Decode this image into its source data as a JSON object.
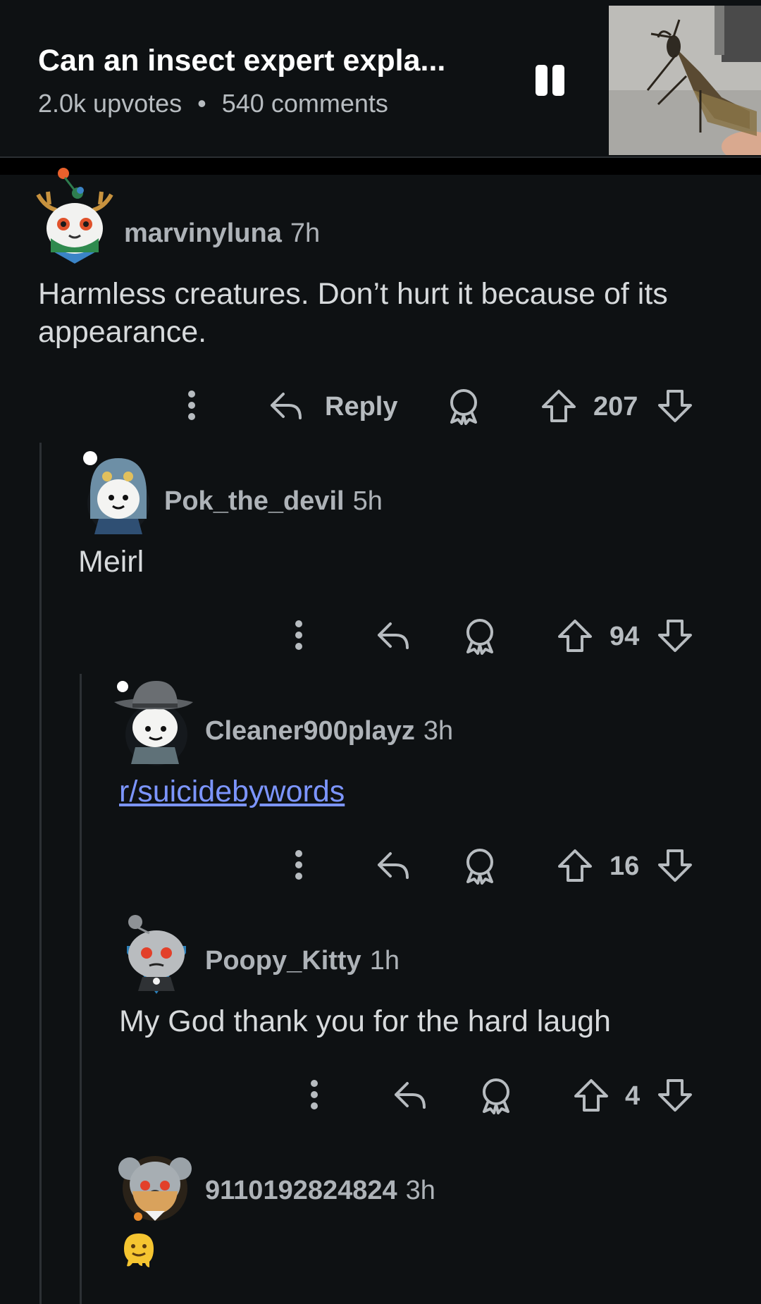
{
  "post": {
    "title": "Can an insect expert expla...",
    "upvotes": "2.0k upvotes",
    "separator": "•",
    "comments": "540 comments"
  },
  "actions": {
    "reply_label": "Reply"
  },
  "comments": [
    {
      "author": "marvinyluna",
      "age": "7h",
      "body": "Harmless creatures. Don’t hurt it because of its appearance.",
      "score": "207"
    },
    {
      "author": "Pok_the_devil",
      "age": "5h",
      "body": "Meirl",
      "score": "94"
    },
    {
      "author": "Cleaner900playz",
      "age": "3h",
      "body": "r/suicidebywords",
      "score": "16"
    },
    {
      "author": "Poopy_Kitty",
      "age": "1h",
      "body": "My God thank you for the hard laugh",
      "score": "4"
    },
    {
      "author": "9110192824824",
      "age": "3h",
      "body": "🫠"
    }
  ],
  "icons": {
    "more": "more-options-icon",
    "reply": "reply-arrow-icon",
    "award": "award-icon",
    "upvote": "upvote-arrow-icon",
    "downvote": "downvote-arrow-icon",
    "pause": "pause-icon"
  },
  "colors": {
    "background": "#0e1113",
    "link": "#7c95ff",
    "muted": "#aeb3b8"
  }
}
